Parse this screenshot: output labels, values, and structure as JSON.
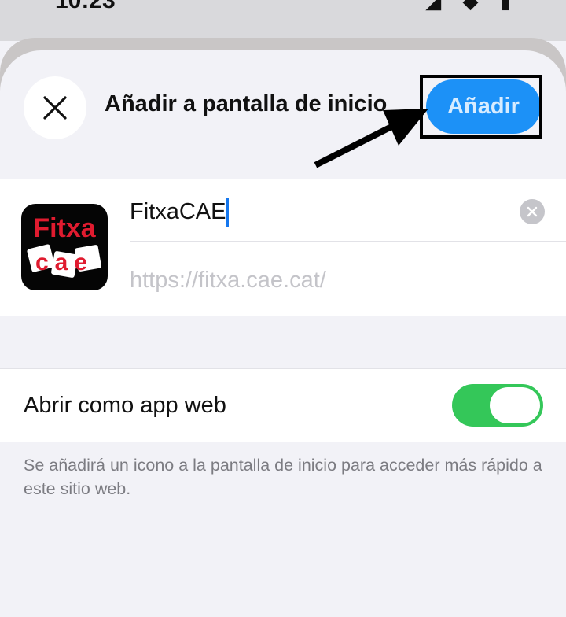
{
  "status_bar": {
    "time": "10:23",
    "icons": "◢ ◆ ▮"
  },
  "header": {
    "close_icon": "close-icon",
    "title": "Añadir a pantalla de inicio",
    "add_label": "Añadir",
    "add_color": "#1c91f7"
  },
  "app_entry": {
    "icon": {
      "name": "fitxacae-app-icon",
      "line1": "Fitxa",
      "line2": "cae",
      "colors": {
        "background": "#050505",
        "text": "#e01b2f",
        "tile": "#ffffff"
      }
    },
    "name_value": "FitxaCAE",
    "clear_icon": "clear-text-icon",
    "url_value": "https://fitxa.cae.cat/"
  },
  "web_app_option": {
    "label": "Abrir como app web",
    "enabled": true,
    "on_color": "#34c759"
  },
  "footnote": "Se añadirá un icono a la pantalla de inicio para acceder más rápido a este sitio web."
}
